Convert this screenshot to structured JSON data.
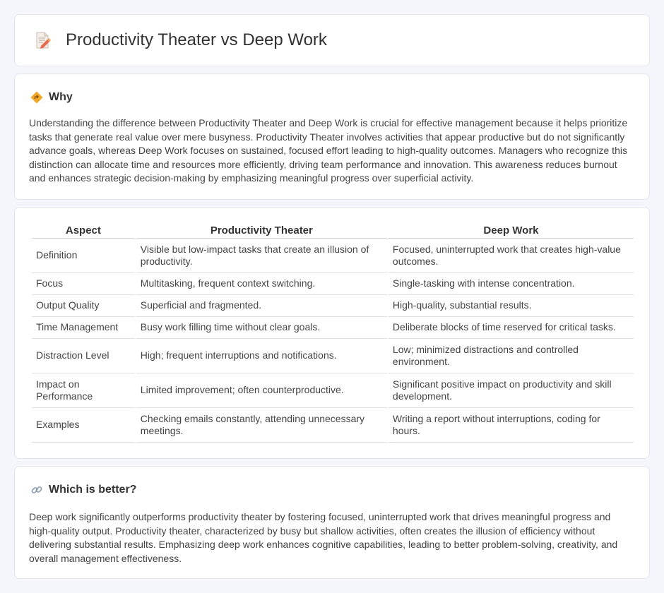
{
  "header": {
    "title": "Productivity Theater vs Deep Work",
    "icon": "document-edit-icon"
  },
  "why": {
    "title": "Why",
    "icon": "diamond-signpost-icon",
    "body": "Understanding the difference between Productivity Theater and Deep Work is crucial for effective management because it helps prioritize tasks that generate real value over mere busyness. Productivity Theater involves activities that appear productive but do not significantly advance goals, whereas Deep Work focuses on sustained, focused effort leading to high-quality outcomes. Managers who recognize this distinction can allocate time and resources more efficiently, driving team performance and innovation. This awareness reduces burnout and enhances strategic decision-making by emphasizing meaningful progress over superficial activity."
  },
  "table": {
    "headers": [
      "Aspect",
      "Productivity Theater",
      "Deep Work"
    ],
    "rows": [
      [
        "Definition",
        "Visible but low-impact tasks that create an illusion of productivity.",
        "Focused, uninterrupted work that creates high-value outcomes."
      ],
      [
        "Focus",
        "Multitasking, frequent context switching.",
        "Single-tasking with intense concentration."
      ],
      [
        "Output Quality",
        "Superficial and fragmented.",
        "High-quality, substantial results."
      ],
      [
        "Time Management",
        "Busy work filling time without clear goals.",
        "Deliberate blocks of time reserved for critical tasks."
      ],
      [
        "Distraction Level",
        "High; frequent interruptions and notifications.",
        "Low; minimized distractions and controlled environment."
      ],
      [
        "Impact on Performance",
        "Limited improvement; often counterproductive.",
        "Significant positive impact on productivity and skill development."
      ],
      [
        "Examples",
        "Checking emails constantly, attending unnecessary meetings.",
        "Writing a report without interruptions, coding for hours."
      ]
    ]
  },
  "better": {
    "title": "Which is better?",
    "icon": "link-icon",
    "body": "Deep work significantly outperforms productivity theater by fostering focused, uninterrupted work that drives meaningful progress and high-quality output. Productivity theater, characterized by busy but shallow activities, often creates the illusion of efficiency without delivering substantial results. Emphasizing deep work enhances cognitive capabilities, leading to better problem-solving, creativity, and overall management effectiveness."
  },
  "colors": {
    "background": "#f4f6fb",
    "card": "#ffffff",
    "diamond_icon": "#f5a623",
    "link_icon": "#8a9bb0"
  }
}
